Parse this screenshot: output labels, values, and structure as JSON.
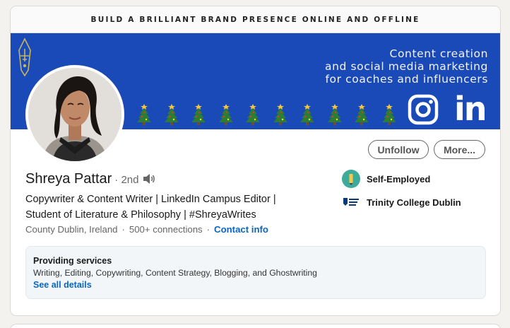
{
  "banner": {
    "tagline": "BUILD A BRILLIANT BRAND PRESENCE ONLINE AND OFFLINE",
    "line1": "Content creation",
    "line2": "and social media marketing",
    "line3": "for coaches and influencers",
    "icons": [
      "pen-logo-icon",
      "christmas-tree-icon",
      "instagram-icon",
      "linkedin-icon"
    ],
    "linkedin_mark": "in",
    "tree_count": 10,
    "colors": {
      "banner_blue": "#1a49b8",
      "tree_green": "#2e7d32",
      "accent_gold": "#c8b560"
    }
  },
  "profile": {
    "name": "Shreya Pattar",
    "degree": "· 2nd",
    "headline_line1": "Copywriter & Content Writer | LinkedIn Campus Editor |",
    "headline_line2": "Student of Literature & Philosophy | #ShreyaWrites",
    "location": "County Dublin, Ireland",
    "connections": "500+ connections",
    "contact_link": "Contact info"
  },
  "actions": {
    "unfollow": "Unfollow",
    "more": "More..."
  },
  "sidebar": {
    "items": [
      {
        "label": "Self-Employed",
        "icon": "self-employed-icon"
      },
      {
        "label": "Trinity College Dublin",
        "icon": "trinity-college-logo-icon"
      }
    ]
  },
  "services": {
    "title": "Providing services",
    "list": "Writing, Editing, Copywriting, Content Strategy, Blogging, and Ghostwriting",
    "link": "See all details"
  },
  "theme": {
    "link_blue": "#0a66c2",
    "text_primary": "#191919",
    "text_secondary": "#666666"
  }
}
